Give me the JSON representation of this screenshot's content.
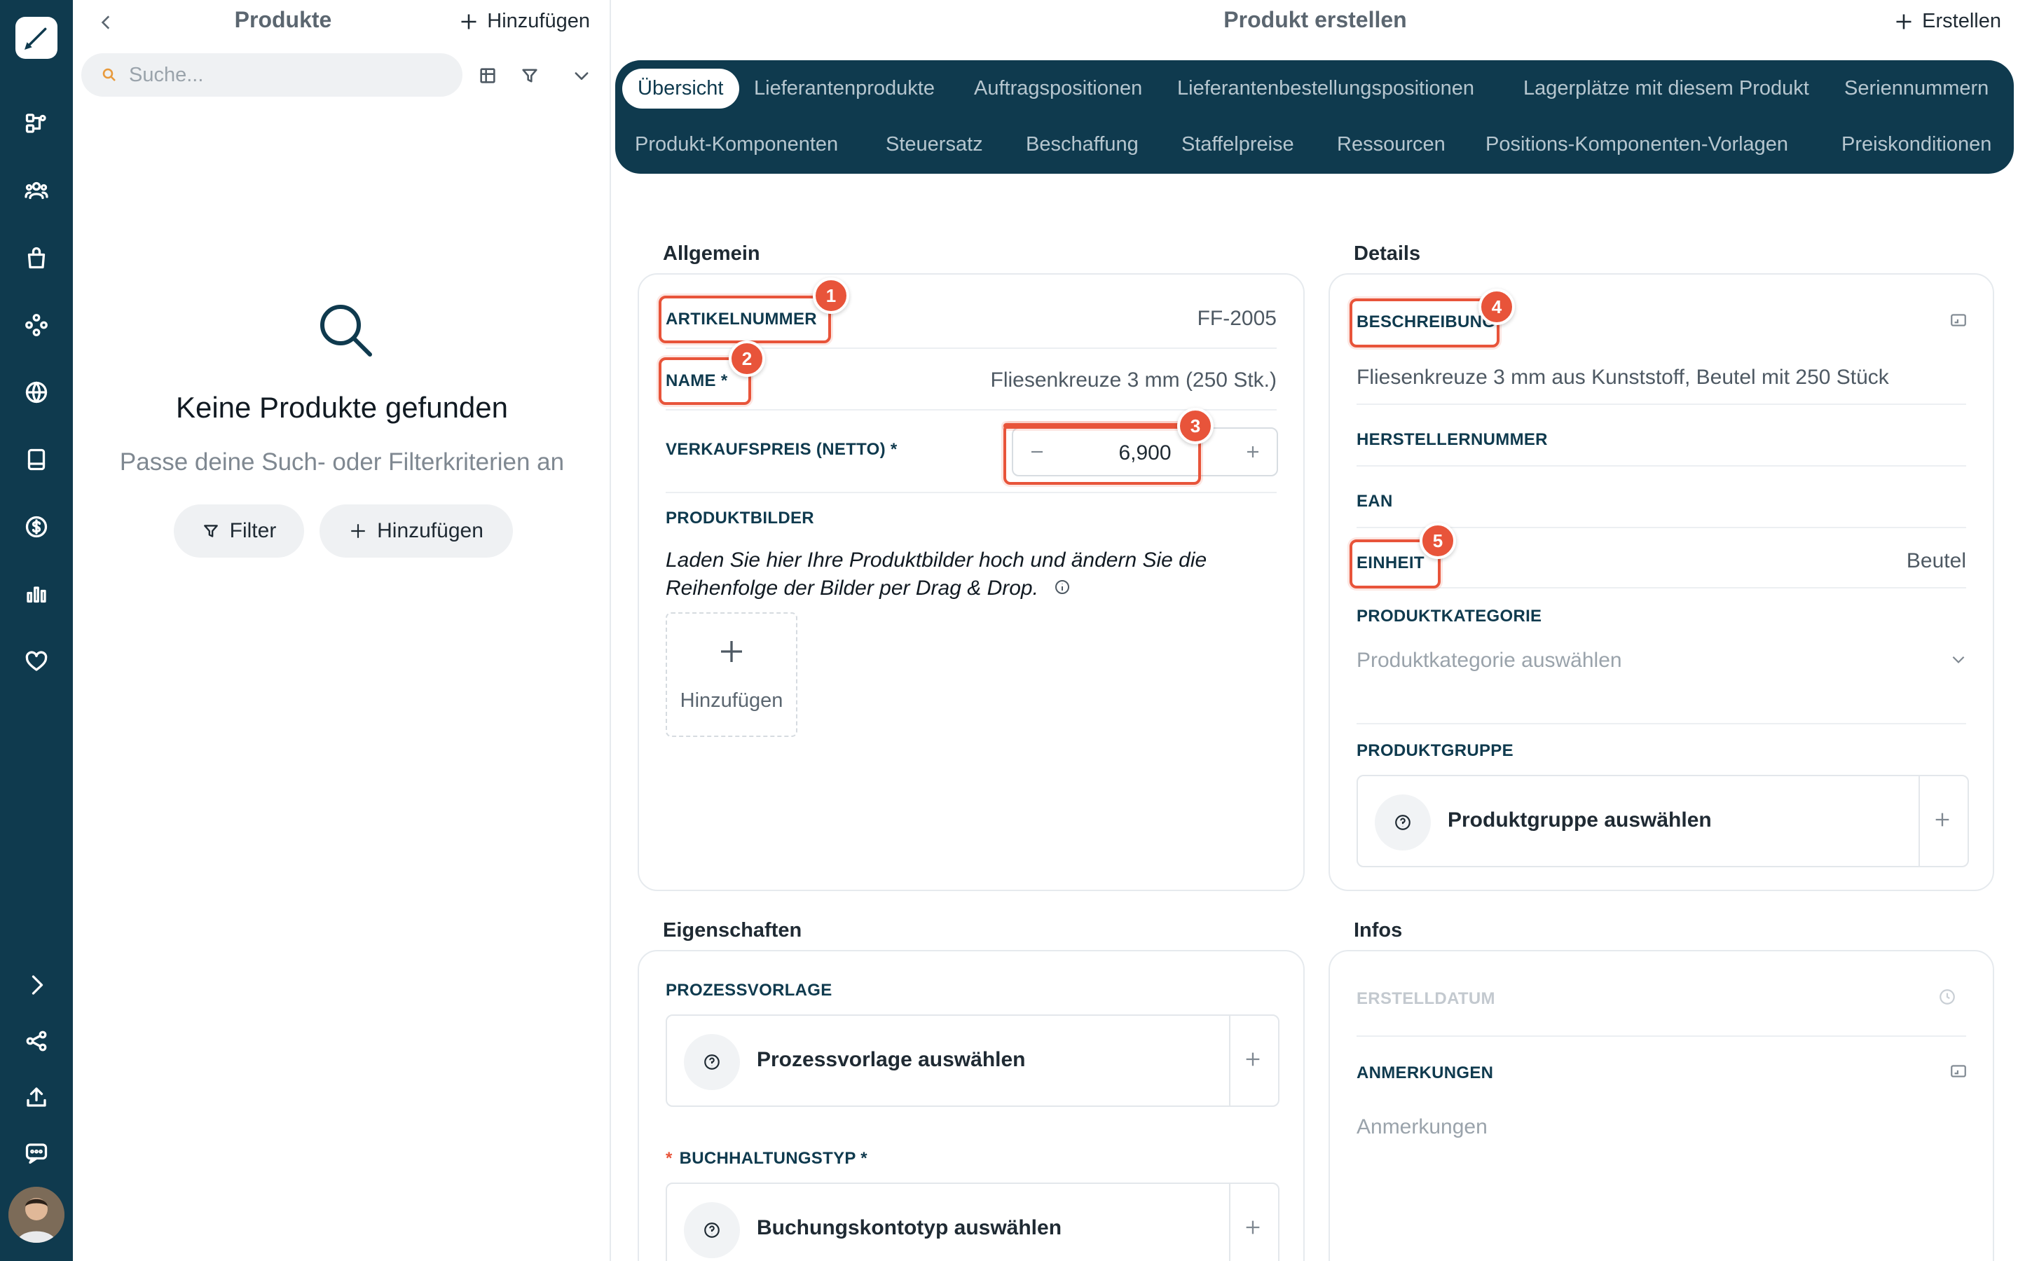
{
  "sidebar": {
    "icons": [
      "logo-pen-icon",
      "workflow-icon",
      "users-icon",
      "bag-icon",
      "modules-icon",
      "globe-icon",
      "document-icon",
      "dollar-icon",
      "chart-icon",
      "heart-icon",
      "expand-icon",
      "share-icon",
      "upload-icon",
      "chat-icon"
    ]
  },
  "list_panel": {
    "title": "Produkte",
    "add_label": "Hinzufügen",
    "search_placeholder": "Suche...",
    "empty_title": "Keine Produkte gefunden",
    "empty_subtitle": "Passe deine Such- oder Filterkriterien an",
    "filter_label": "Filter",
    "empty_add_label": "Hinzufügen"
  },
  "main": {
    "title": "Produkt erstellen",
    "create_label": "Erstellen",
    "tabs_row1": [
      "Übersicht",
      "Lieferantenprodukte",
      "Auftragspositionen",
      "Lieferantenbestellungspositionen",
      "Lagerplätze mit diesem Produkt",
      "Seriennummern"
    ],
    "tabs_row2": [
      "Produkt-Komponenten",
      "Steuersatz",
      "Beschaffung",
      "Staffelpreise",
      "Ressourcen",
      "Positions-Komponenten-Vorlagen",
      "Preiskonditionen"
    ]
  },
  "allgemein": {
    "section": "Allgemein",
    "artikelnummer_label": "ARTIKELNUMMER",
    "artikelnummer_value": "FF-2005",
    "name_label": "NAME *",
    "name_value": "Fliesenkreuze 3 mm (250 Stk.)",
    "preis_label": "VERKAUFSPREIS (NETTO) *",
    "preis_value": "6,900",
    "bilder_label": "PRODUKTBILDER",
    "bilder_text_1": "Laden Sie hier Ihre Produktbilder hoch und ändern Sie die",
    "bilder_text_2": "Reihenfolge der Bilder per Drag & Drop.",
    "upload_label": "Hinzufügen"
  },
  "details": {
    "section": "Details",
    "beschreibung_label": "BESCHREIBUNG",
    "beschreibung_value": "Fliesenkreuze 3 mm aus Kunststoff, Beutel mit 250 Stück",
    "herstellernummer_label": "HERSTELLERNUMMER",
    "ean_label": "EAN",
    "einheit_label": "EINHEIT",
    "einheit_value": "Beutel",
    "kategorie_label": "PRODUKTKATEGORIE",
    "kategorie_placeholder": "Produktkategorie auswählen",
    "gruppe_label": "PRODUKTGRUPPE",
    "gruppe_select": "Produktgruppe auswählen"
  },
  "eigenschaften": {
    "section": "Eigenschaften",
    "prozess_label": "PROZESSVORLAGE",
    "prozess_select": "Prozessvorlage auswählen",
    "buchhaltung_star": "*",
    "buchhaltung_label": "BUCHHALTUNGSTYP *",
    "buchhaltung_select": "Buchungskontotyp auswählen"
  },
  "infos": {
    "section": "Infos",
    "erstelldatum_label": "ERSTELLDATUM",
    "anmerkungen_label": "ANMERKUNGEN",
    "anmerkungen_placeholder": "Anmerkungen"
  },
  "annotations": {
    "badges": [
      "1",
      "2",
      "3",
      "4",
      "5"
    ],
    "color": "#e8543a"
  },
  "colors": {
    "brand": "#0f3a4e",
    "accent": "#e8543a"
  }
}
